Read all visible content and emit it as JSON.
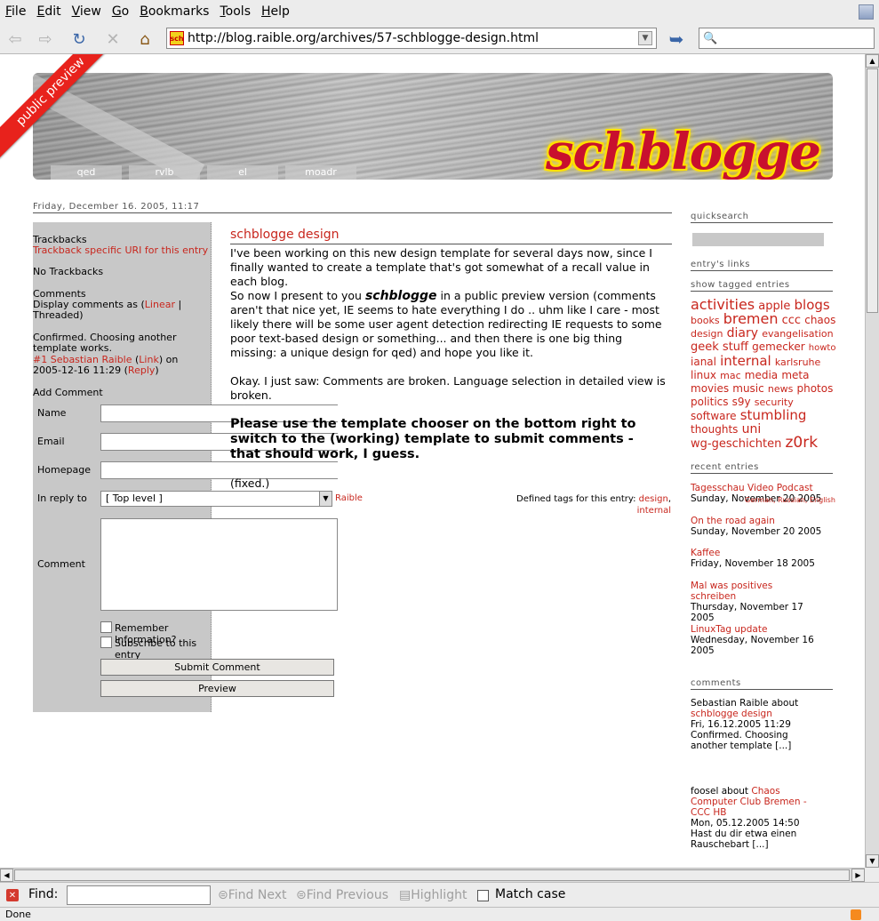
{
  "menubar": {
    "items": [
      {
        "ul": "F",
        "rest": "ile"
      },
      {
        "ul": "E",
        "rest": "dit"
      },
      {
        "ul": "V",
        "rest": "iew"
      },
      {
        "ul": "G",
        "rest": "o"
      },
      {
        "ul": "B",
        "rest": "ookmarks"
      },
      {
        "ul": "T",
        "rest": "ools"
      },
      {
        "ul": "H",
        "rest": "elp"
      }
    ]
  },
  "navbar": {
    "url": "http://blog.raible.org/archives/57-schblogge-design.html",
    "favicon_text": "sch",
    "search_glyph": "🔍"
  },
  "banner": {
    "site_title": "schblogge",
    "ribbon": "public preview",
    "tabs": [
      "qed",
      "rvlb",
      "el",
      "moadr"
    ]
  },
  "entry": {
    "date": "Friday, December 16. 2005, 11:17",
    "title": "schblogge design",
    "p1": "I've been working on this new design template for several days now, since I finally wanted to create a template that's got somewhat of a recall value in each blog.",
    "p2a": "So now I present to you ",
    "p2brand": "schblogge",
    "p2b": " in a public preview version (comments aren't that nice yet, IE seems to hate everything I do .. uhm like I care - most likely there will be some user agent detection redirecting IE requests to some poor text-based design or something... and then there is one big thing missing: a unique design for qed) and hope you like it.",
    "p3": "Okay. I just saw: Comments are broken. Language selection in detailed view is broken.",
    "notice": "Please use the template chooser on the bottom right to switch to the (working) template to submit comments - that should work, I guess.",
    "fixed": "(fixed.)",
    "tags_label": "Defined tags for this entry:",
    "tag1": "design",
    "tag2": "internal"
  },
  "leftpanel": {
    "trackbacks_head": "Trackbacks",
    "trackback_uri": "Trackback specific URI for this entry",
    "no_trackbacks": "No Trackbacks",
    "comments_head": "Comments",
    "display_as": "Display comments as (",
    "linear": "Linear",
    "pipe": " | ",
    "threaded": "Threaded)",
    "comment_text": "Confirmed. Choosing another template works.",
    "comment_author": "#1 Sebastian Raible",
    "link_open": " (",
    "link": "Link",
    "link_close": ") on",
    "comment_date": "2005-12-16 11:29 (",
    "reply": "Reply",
    "reply_close": ")",
    "add_comment": "Add Comment",
    "label_name": "Name",
    "label_email": "Email",
    "label_homepage": "Homepage",
    "label_inreply": "In reply to",
    "reply_select": "[ Top level ]",
    "reply_name": "Raible",
    "label_comment": "Comment",
    "remember": "Remember Information?",
    "subscribe": "Subscribe to this entry",
    "submit": "Submit Comment",
    "preview": "Preview"
  },
  "sidebar": {
    "quicksearch": "quicksearch",
    "entrys_links": "entry's links",
    "show_tagged": "show tagged entries",
    "recent_entries": "recent entries",
    "comments_head": "comments",
    "lang_overlap": "German, Russian, English",
    "tags": [
      {
        "t": "activities",
        "s": "16px"
      },
      {
        "t": "apple",
        "s": "13px"
      },
      {
        "t": "blogs",
        "s": "15px"
      },
      {
        "t": "books",
        "s": "11px"
      },
      {
        "t": "bremen",
        "s": "16px"
      },
      {
        "t": "ccc",
        "s": "13px"
      },
      {
        "t": "chaos",
        "s": "12px"
      },
      {
        "t": "design",
        "s": "11px"
      },
      {
        "t": "diary",
        "s": "14px"
      },
      {
        "t": "evangelisation",
        "s": "11px"
      },
      {
        "t": "geek",
        "s": "13px"
      },
      {
        "t": "stuff",
        "s": "13px"
      },
      {
        "t": "gemecker",
        "s": "12px"
      },
      {
        "t": "howto",
        "s": "10px"
      },
      {
        "t": "ianal",
        "s": "12px"
      },
      {
        "t": "internal",
        "s": "15px"
      },
      {
        "t": "karlsruhe",
        "s": "11px"
      },
      {
        "t": "linux",
        "s": "12px"
      },
      {
        "t": "mac",
        "s": "11px"
      },
      {
        "t": "media",
        "s": "12px"
      },
      {
        "t": "meta",
        "s": "12px"
      },
      {
        "t": "movies",
        "s": "12px"
      },
      {
        "t": "music",
        "s": "12px"
      },
      {
        "t": "news",
        "s": "11px"
      },
      {
        "t": "photos",
        "s": "12px"
      },
      {
        "t": "politics",
        "s": "12px"
      },
      {
        "t": "s9y",
        "s": "12px"
      },
      {
        "t": "security",
        "s": "11px"
      },
      {
        "t": "software",
        "s": "12px"
      },
      {
        "t": "stumbling",
        "s": "15px"
      },
      {
        "t": "thoughts",
        "s": "12px"
      },
      {
        "t": "uni",
        "s": "14px"
      },
      {
        "t": "wg-geschichten",
        "s": "13px"
      },
      {
        "t": "z0rk",
        "s": "17px"
      }
    ],
    "recent": [
      {
        "title": "Tagesschau Video Podcast",
        "date": "Sunday, November 20 2005"
      },
      {
        "title": "On the road again",
        "date": "Sunday, November 20 2005"
      },
      {
        "title": "Kaffee",
        "date": "Friday, November 18 2005"
      },
      {
        "title": "Mal was positives schreiben",
        "date": "Thursday, November 17 2005"
      },
      {
        "title": "LinuxTag update",
        "date": "Wednesday, November 16 2005"
      }
    ],
    "c1_author": "Sebastian Raible about",
    "c1_link": "schblogge design",
    "c1_date": "Fri, 16.12.2005 11:29",
    "c1_text": "Confirmed. Choosing another template [...]",
    "c2_author": "foosel about ",
    "c2_link": "Chaos Computer Club Bremen - CCC HB",
    "c2_date": "Mon, 05.12.2005 14:50",
    "c2_text": "Hast du dir etwa einen Rauschebart [...]"
  },
  "findbar": {
    "label": "Find:",
    "find_next": "Find Next",
    "find_prev": "Find Previous",
    "highlight": "Highlight",
    "match_case": "Match case"
  },
  "status": {
    "text": "Done"
  }
}
